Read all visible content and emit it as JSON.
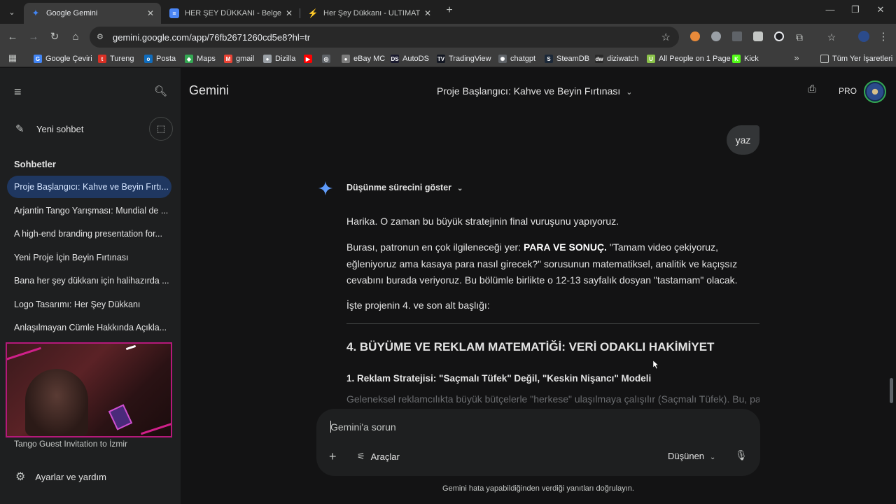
{
  "browser": {
    "tabs": [
      {
        "title": "Google Gemini",
        "active": true,
        "favicon_color": "#4285f4"
      },
      {
        "title": "HER ŞEY DÜKKANI - Belge",
        "active": false,
        "favicon_color": "#4a86f7"
      },
      {
        "title": "Her Şey Dükkanı - ULTIMATE FI",
        "active": false,
        "favicon_color": "#8a4fff"
      }
    ],
    "url": "gemini.google.com/app/76fb2671260cd5e8?hl=tr",
    "bookmarks": [
      {
        "label": "Google Çeviri",
        "color": "#4285f4",
        "glyph": "G"
      },
      {
        "label": "Tureng",
        "color": "#d93025",
        "glyph": "t"
      },
      {
        "label": "Posta",
        "color": "#0f6cbd",
        "glyph": "o"
      },
      {
        "label": "Maps",
        "color": "#34a853",
        "glyph": "◆"
      },
      {
        "label": "gmail",
        "color": "#ea4335",
        "glyph": "M"
      },
      {
        "label": "Dizilla",
        "color": "#9aa0a6",
        "glyph": "●"
      },
      {
        "label": "",
        "color": "#ff0000",
        "glyph": "▶"
      },
      {
        "label": "",
        "color": "#5f6368",
        "glyph": "◎"
      },
      {
        "label": "eBay MC",
        "color": "#7c7c7c",
        "glyph": "●"
      },
      {
        "label": "AutoDS",
        "color": "#1a1a2e",
        "glyph": "DS"
      },
      {
        "label": "TradingView",
        "color": "#131722",
        "glyph": "TV"
      },
      {
        "label": "chatgpt",
        "color": "#5f6368",
        "glyph": "✺"
      },
      {
        "label": "SteamDB",
        "color": "#1b2838",
        "glyph": "S"
      },
      {
        "label": "diziwatch",
        "color": "#2a2a2a",
        "glyph": "dw"
      },
      {
        "label": "All People on 1 Page",
        "color": "#8bc34a",
        "glyph": "U"
      },
      {
        "label": "Kick",
        "color": "#53fc18",
        "glyph": "K"
      }
    ],
    "all_bookmarks": "Tüm Yer İşaretleri"
  },
  "sidebar": {
    "new_chat": "Yeni sohbet",
    "heading": "Sohbetler",
    "chats": [
      "Proje Başlangıcı: Kahve ve Beyin Fırtı...",
      "Arjantin Tango Yarışması: Mundial de ...",
      "A high-end branding presentation for...",
      "Yeni Proje İçin Beyin Fırtınası",
      "Bana her şey dükkanı için halihazırda ...",
      "Logo Tasarımı: Her Şey Dükkanı",
      "Anlaşılmayan Cümle Hakkında Açıkla..."
    ],
    "partial_chat": "Tango Guest Invitation to İzmir",
    "settings": "Ayarlar ve yardım"
  },
  "header": {
    "brand": "Gemini",
    "conversation_title": "Proje Başlangıcı: Kahve ve Beyin Fırtınası",
    "plan": "PRO"
  },
  "conversation": {
    "user_message": "yaz",
    "thinking_label": "Düşünme sürecini göster",
    "p1": "Harika. O zaman bu büyük stratejinin final vuruşunu yapıyoruz.",
    "p2_lead": "Burası, patronun en çok ilgileneceği yer: ",
    "p2_bold": "PARA VE SONUÇ.",
    "p2_rest": " \"Tamam video çekiyoruz, eğleniyoruz ama kasaya para nasıl girecek?\" sorusunun matematiksel, analitik ve kaçışsız cevabını burada veriyoruz. Bu bölümle birlikte o 12-13 sayfalık dosyan \"tastamam\" olacak.",
    "p3": "İşte projenin 4. ve son alt başlığı:",
    "heading": "4. BÜYÜME VE REKLAM MATEMATİĞİ: VERİ ODAKLI HAKİMİYET",
    "subheading": "1. Reklam Stratejisi: \"Saçmalı Tüfek\" Değil, \"Keskin Nişancı\" Modeli",
    "fade_text": "Geleneksel reklamcılıkta büyük bütçelerle \"herkese\" ulaşılmaya çalışılır (Saçmalı Tüfek). Bu, parayı"
  },
  "composer": {
    "placeholder": "Gemini'a sorun",
    "tools": "Araçlar",
    "mode": "Düşünen"
  },
  "disclaimer": "Gemini hata yapabildiğinden verdiği yanıtları doğrulayın."
}
